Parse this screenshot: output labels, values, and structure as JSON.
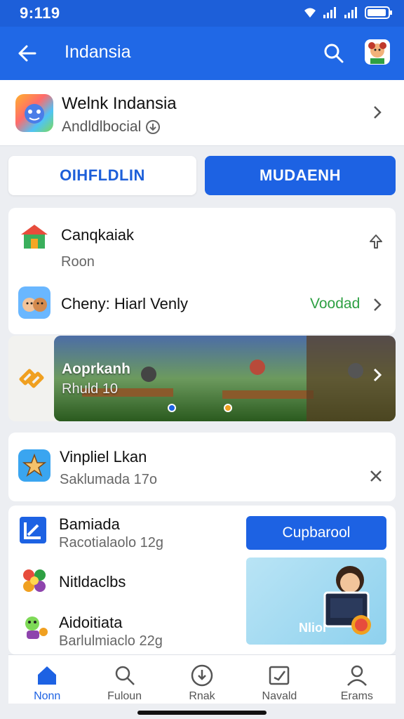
{
  "status_bar": {
    "time": "9:119"
  },
  "app_bar": {
    "title": "Indansia",
    "icons": [
      "back-arrow-icon",
      "search-icon",
      "avatar-icon"
    ]
  },
  "app_header": {
    "title": "Welnk Indansia",
    "subtitle": "Andldlbocial",
    "icon": "app-icon"
  },
  "tabs": [
    {
      "label": "OIHFLDLIN"
    },
    {
      "label": "MUDAENH"
    }
  ],
  "list1": {
    "items": [
      {
        "title": "Canqkaiak",
        "subtitle": "Roon",
        "icon": "house-icon"
      },
      {
        "title": "Cheny: Hiarl Venly",
        "status": "Voodad",
        "icon": "cartoon-icon"
      }
    ]
  },
  "banner": {
    "title": "Aoprkanh",
    "subtitle": "Rhuld 10"
  },
  "list2": {
    "title": "Vinpliel Lkan",
    "subtitle": "Saklumada 17o"
  },
  "list3": {
    "items": [
      {
        "title": "Bamiada",
        "subtitle": "Racotialaolo 12g"
      },
      {
        "title": "Nitldaclbs"
      },
      {
        "title": "Aidoitiata",
        "subtitle": "Barlulmiaclo 22g"
      }
    ],
    "cta": "Cupbarool",
    "promo_text": "Nliol"
  },
  "bottom_nav": [
    {
      "label": "Nonn",
      "icon": "home-icon"
    },
    {
      "label": "Fuloun",
      "icon": "search-icon"
    },
    {
      "label": "Rnak",
      "icon": "download-icon"
    },
    {
      "label": "Navald",
      "icon": "edit-icon"
    },
    {
      "label": "Erams",
      "icon": "profile-icon"
    }
  ],
  "colors": {
    "primary": "#2068e6",
    "accent_green": "#2ea043"
  }
}
